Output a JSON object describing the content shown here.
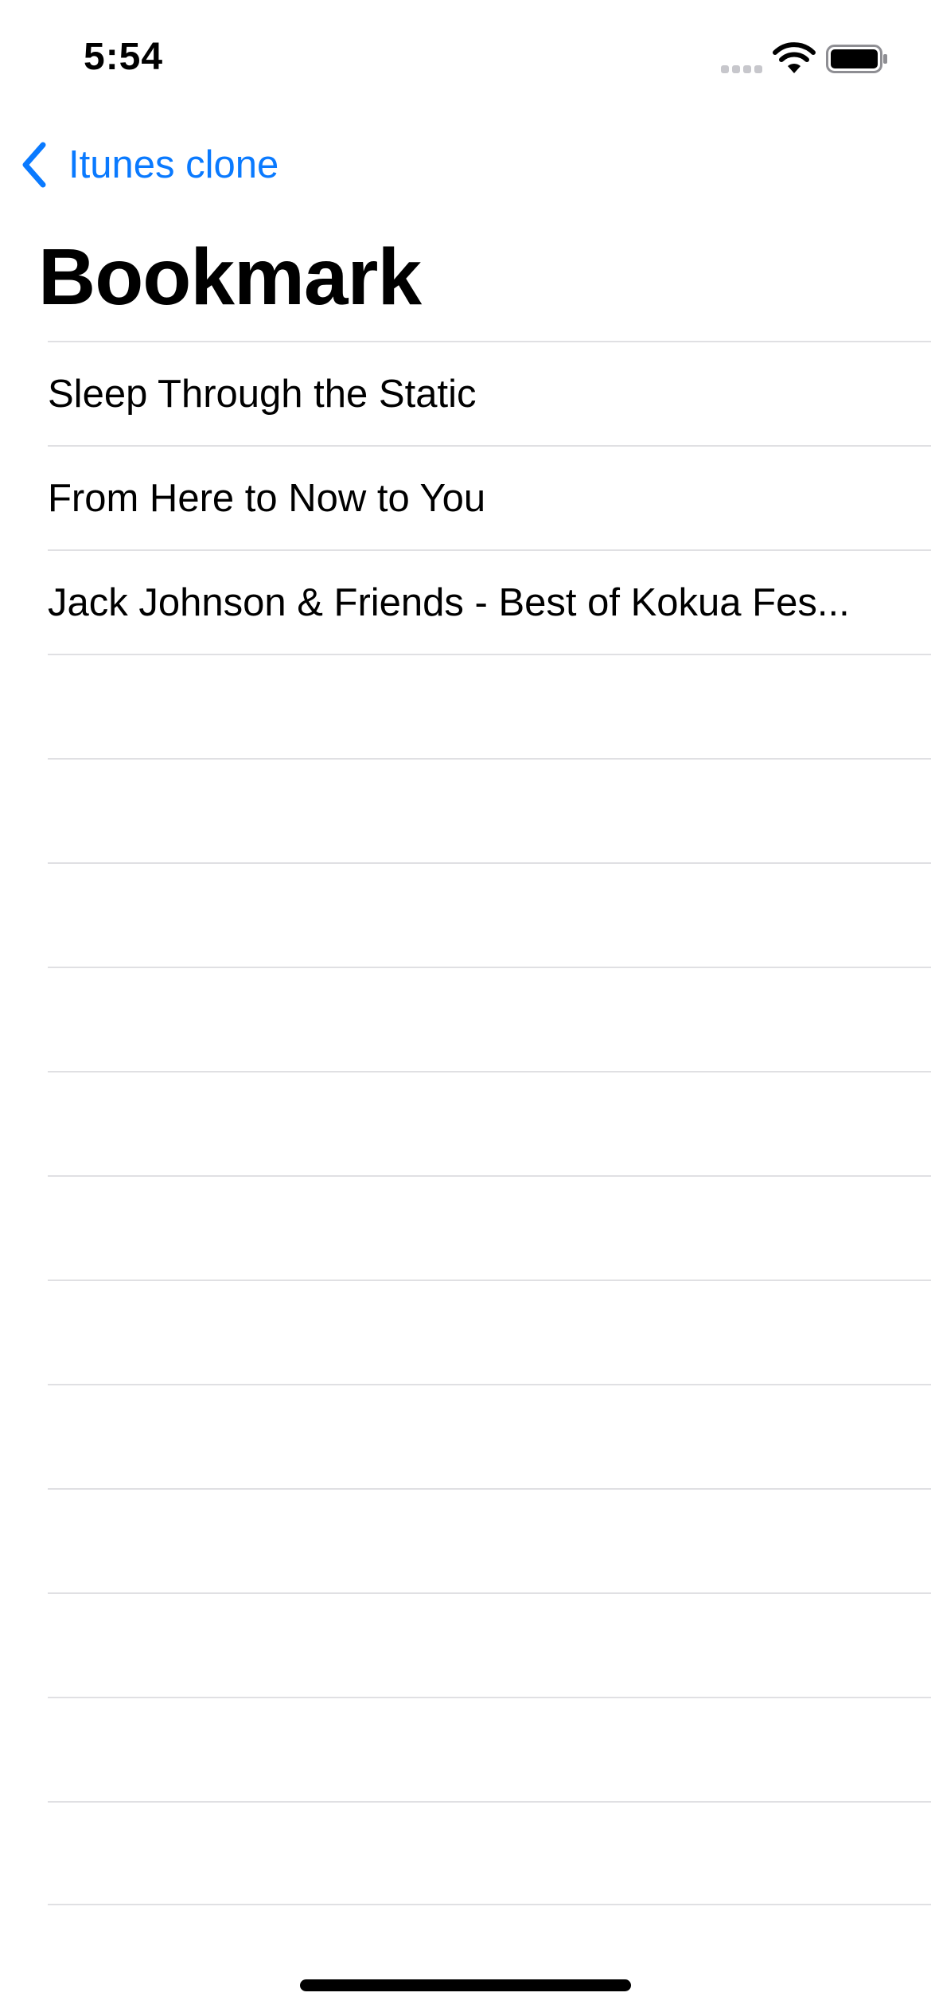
{
  "status_bar": {
    "time": "5:54",
    "icons": [
      "cellular-signal-icon",
      "wifi-icon",
      "battery-icon"
    ]
  },
  "nav": {
    "back_label": "Itunes clone",
    "back_icon": "chevron-left-icon",
    "accent_color": "#0a7aff"
  },
  "title": "Bookmark",
  "bookmarks": [
    {
      "label": "Sleep Through the Static"
    },
    {
      "label": "From Here to Now to You"
    },
    {
      "label": "Jack Johnson & Friends - Best of Kokua Fes..."
    }
  ],
  "empty_rows": 12
}
